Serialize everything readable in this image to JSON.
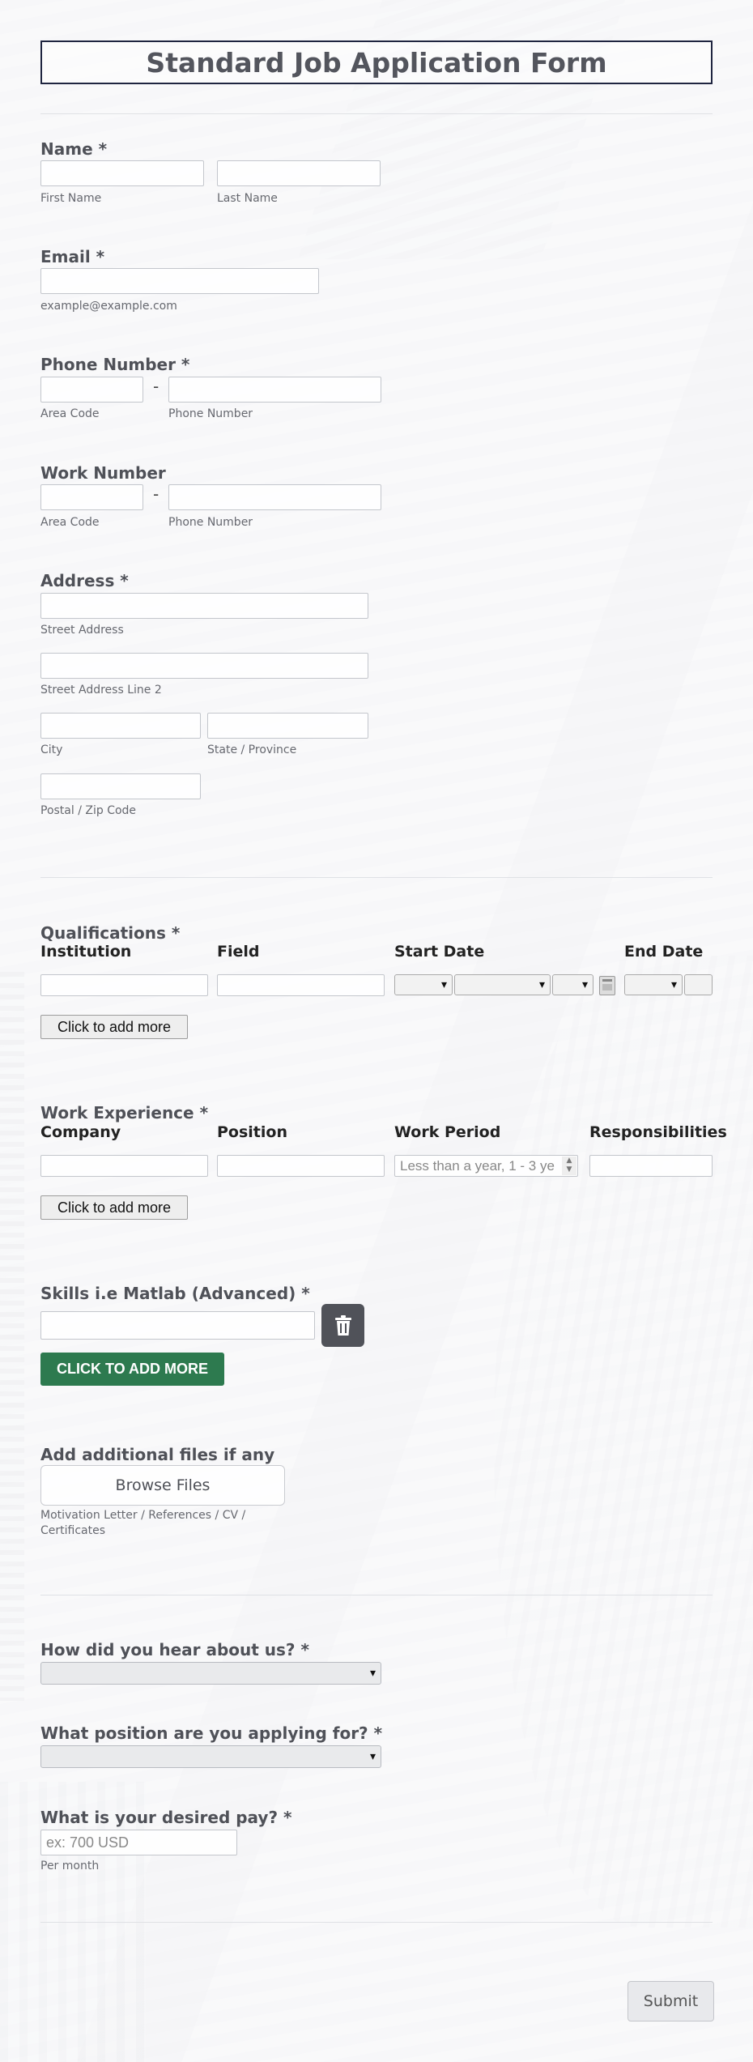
{
  "form": {
    "title": "Standard Job Application Form",
    "name": {
      "label": "Name *",
      "first_sub": "First Name",
      "last_sub": "Last Name"
    },
    "email": {
      "label": "Email *",
      "sub": "example@example.com"
    },
    "phone": {
      "label": "Phone Number *",
      "area_sub": "Area Code",
      "number_sub": "Phone Number",
      "sep": "-"
    },
    "work_number": {
      "label": "Work Number",
      "area_sub": "Area Code",
      "number_sub": "Phone Number",
      "sep": "-"
    },
    "address": {
      "label": "Address *",
      "street_sub": "Street Address",
      "street2_sub": "Street Address Line 2",
      "city_sub": "City",
      "state_sub": "State / Province",
      "zip_sub": "Postal / Zip Code"
    },
    "qualifications": {
      "label": "Qualifications *",
      "columns": [
        "Institution",
        "Field",
        "Start Date",
        "End Date"
      ],
      "add_more": "Click to add more"
    },
    "work_experience": {
      "label": "Work Experience *",
      "columns": [
        "Company",
        "Position",
        "Work Period",
        "Responsibilities"
      ],
      "period_placeholder": "Less than a year, 1 - 3 ye",
      "add_more": "Click to add more"
    },
    "skills": {
      "label": "Skills i.e Matlab (Advanced) *",
      "add_more": "CLICK TO ADD MORE"
    },
    "files": {
      "label": "Add additional files if any",
      "browse": "Browse Files",
      "sub": "Motivation Letter / References / CV / Certificates"
    },
    "hear_about": {
      "label": "How did you hear about us? *",
      "value": ""
    },
    "position": {
      "label": "What position are you applying for? *",
      "value": ""
    },
    "pay": {
      "label": "What is your desired pay? *",
      "placeholder": "ex: 700 USD",
      "sub": "Per month"
    },
    "submit": "Submit"
  },
  "icons": {
    "trash": "trash-icon",
    "chevron": "chevron-down-icon",
    "calendar": "calendar-icon"
  },
  "colors": {
    "title_border": "#1f2540",
    "green_button": "#2d7a4f",
    "trash_button": "#505259"
  }
}
